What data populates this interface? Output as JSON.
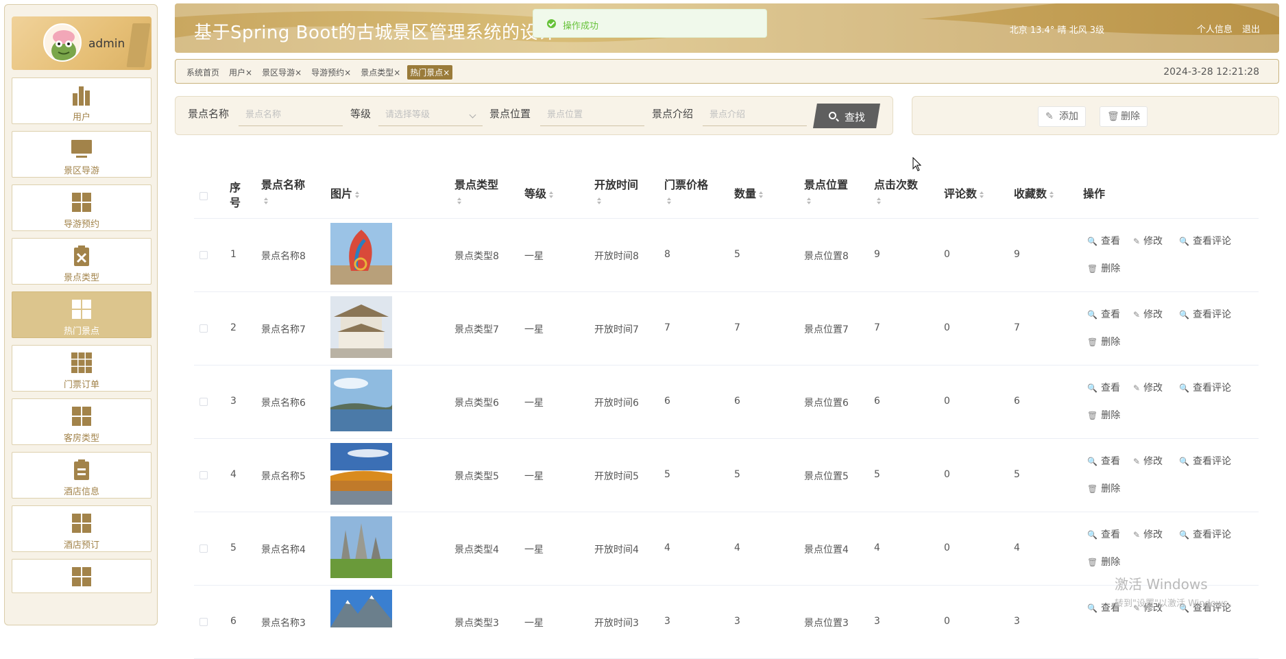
{
  "header": {
    "title": "基于Spring Boot的古城景区管理系统的设计",
    "weather": "北京 13.4° 晴 北风 3级",
    "profile_link": "个人信息",
    "logout_link": "退出"
  },
  "toast": {
    "message": "操作成功"
  },
  "sidebar": {
    "user": "admin",
    "items": [
      {
        "label": "用户",
        "icon": "bar-chart-icon"
      },
      {
        "label": "景区导游",
        "icon": "monitor-icon"
      },
      {
        "label": "导游预约",
        "icon": "grid-icon"
      },
      {
        "label": "景点类型",
        "icon": "clipboard-x-icon"
      },
      {
        "label": "热门景点",
        "icon": "grid-icon",
        "active": true
      },
      {
        "label": "门票订单",
        "icon": "grid9-icon"
      },
      {
        "label": "客房类型",
        "icon": "grid-icon"
      },
      {
        "label": "酒店信息",
        "icon": "clipboard-icon"
      },
      {
        "label": "酒店预订",
        "icon": "grid-icon"
      },
      {
        "label": "",
        "icon": "grid-icon"
      }
    ]
  },
  "tags": [
    "系统首页",
    "用户×",
    "景区导游×",
    "导游预约×",
    "景点类型×",
    "热门景点×"
  ],
  "datetime": "2024-3-28 12:21:28",
  "search": {
    "name_label": "景点名称",
    "name_placeholder": "景点名称",
    "level_label": "等级",
    "level_placeholder": "请选择等级",
    "location_label": "景点位置",
    "location_placeholder": "景点位置",
    "intro_label": "景点介绍",
    "intro_placeholder": "景点介绍",
    "find_button": "查找"
  },
  "actions": {
    "add": "添加",
    "delete": "删除"
  },
  "table": {
    "headers": {
      "index": "序号",
      "name": "景点名称",
      "image": "图片",
      "type": "景点类型",
      "level": "等级",
      "open": "开放时间",
      "price": "门票价格",
      "qty": "数量",
      "location": "景点位置",
      "clicks": "点击次数",
      "comments": "评论数",
      "favs": "收藏数",
      "ops": "操作"
    },
    "ops": {
      "view": "查看",
      "edit": "修改",
      "comments": "查看评论",
      "delete": "删除"
    },
    "rows": [
      {
        "index": "1",
        "name": "景点名称8",
        "type": "景点类型8",
        "level": "一星",
        "open": "开放时间8",
        "price": "8",
        "qty": "5",
        "location": "景点位置8",
        "clicks": "9",
        "comments": "0",
        "favs": "9"
      },
      {
        "index": "2",
        "name": "景点名称7",
        "type": "景点类型7",
        "level": "一星",
        "open": "开放时间7",
        "price": "7",
        "qty": "7",
        "location": "景点位置7",
        "clicks": "7",
        "comments": "0",
        "favs": "7"
      },
      {
        "index": "3",
        "name": "景点名称6",
        "type": "景点类型6",
        "level": "一星",
        "open": "开放时间6",
        "price": "6",
        "qty": "6",
        "location": "景点位置6",
        "clicks": "6",
        "comments": "0",
        "favs": "6"
      },
      {
        "index": "4",
        "name": "景点名称5",
        "type": "景点类型5",
        "level": "一星",
        "open": "开放时间5",
        "price": "5",
        "qty": "5",
        "location": "景点位置5",
        "clicks": "5",
        "comments": "0",
        "favs": "5"
      },
      {
        "index": "5",
        "name": "景点名称4",
        "type": "景点类型4",
        "level": "一星",
        "open": "开放时间4",
        "price": "4",
        "qty": "4",
        "location": "景点位置4",
        "clicks": "4",
        "comments": "0",
        "favs": "4"
      },
      {
        "index": "6",
        "name": "景点名称3",
        "type": "景点类型3",
        "level": "一星",
        "open": "开放时间3",
        "price": "3",
        "qty": "3",
        "location": "景点位置3",
        "clicks": "3",
        "comments": "0",
        "favs": "3"
      }
    ]
  },
  "watermark": {
    "line1": "激活 Windows",
    "line2": "转到\"设置\"以激活 Windows。"
  },
  "colors": {
    "accent": "#c9a760",
    "active_nav": "#dcc58d",
    "icon": "#a2834a",
    "success": "#67c23a"
  }
}
